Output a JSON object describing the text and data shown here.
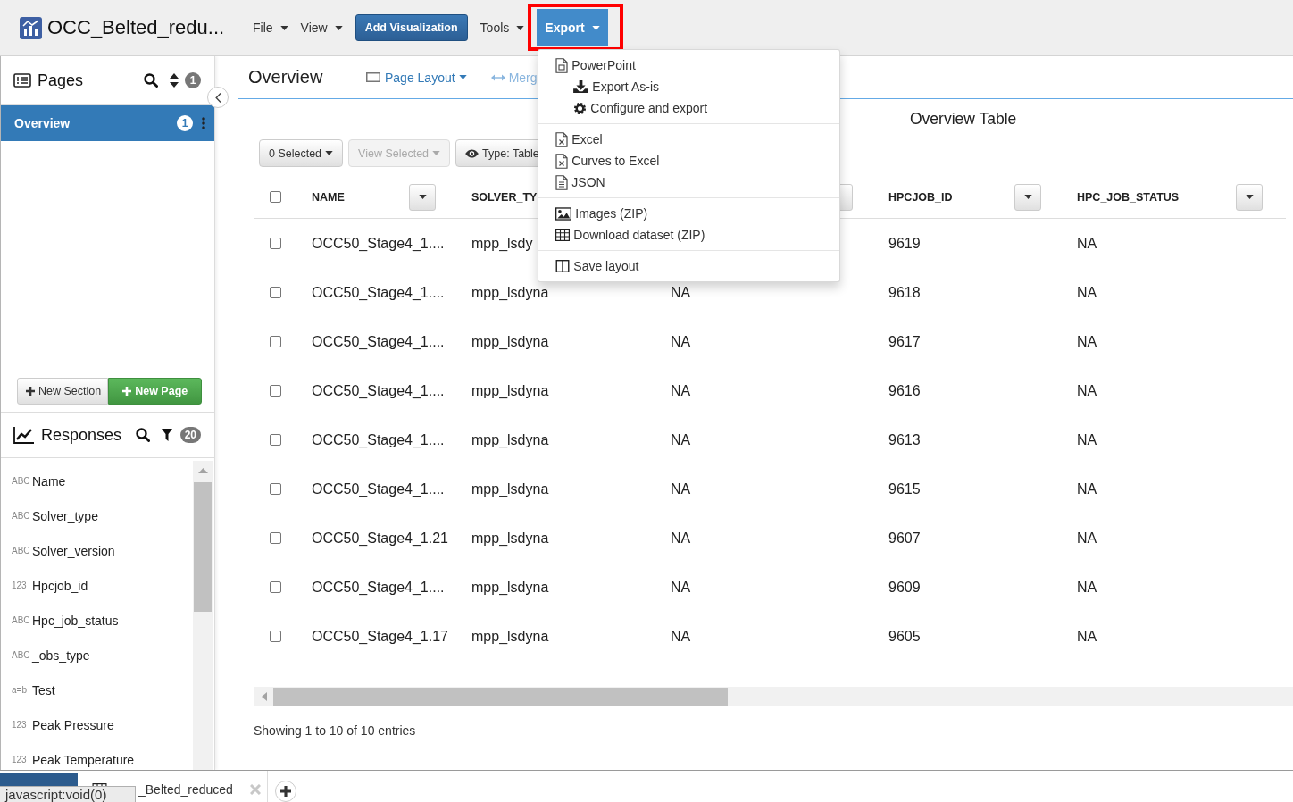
{
  "app_bar": {
    "title": "OCC_Belted_redu...",
    "menu": [
      {
        "label": "File",
        "kind": "dropdown",
        "expanded": false,
        "highlighted": false
      },
      {
        "label": "View",
        "kind": "dropdown",
        "expanded": false,
        "highlighted": false
      },
      {
        "label": "Add Visualization",
        "kind": "button",
        "expanded": false,
        "highlighted": false
      },
      {
        "label": "Tools",
        "kind": "dropdown",
        "expanded": false,
        "highlighted": false
      },
      {
        "label": "Export",
        "kind": "dropdown",
        "expanded": true,
        "highlighted": true,
        "menu": {
          "sections": [
            {
              "items": [
                {
                  "label": "PowerPoint",
                  "kind": "format"
                },
                {
                  "label": "Export As-is",
                  "kind": "action"
                },
                {
                  "label": "Configure and export",
                  "kind": "action"
                }
              ]
            },
            {
              "items": [
                {
                  "label": "Excel",
                  "kind": "format"
                },
                {
                  "label": "Curves to Excel",
                  "kind": "format"
                },
                {
                  "label": "JSON",
                  "kind": "format"
                }
              ]
            },
            {
              "items": [
                {
                  "label": "Images (ZIP)",
                  "kind": "format"
                },
                {
                  "label": "Download dataset (ZIP)",
                  "kind": "format"
                }
              ]
            },
            {
              "items": [
                {
                  "label": "Save layout",
                  "kind": "format"
                }
              ]
            }
          ]
        }
      }
    ]
  },
  "pages_panel": {
    "title": "Pages",
    "count": "1",
    "pages": [
      {
        "label": "Overview",
        "count": "1",
        "selected": true
      }
    ],
    "buttons": [
      {
        "label": "New Section",
        "kind": "default"
      },
      {
        "label": "New Page",
        "kind": "success"
      }
    ]
  },
  "responses_panel": {
    "title": "Responses",
    "count": "20",
    "items": [
      {
        "type": "ABC",
        "label": "Name"
      },
      {
        "type": "ABC",
        "label": "Solver_type"
      },
      {
        "type": "ABC",
        "label": "Solver_version"
      },
      {
        "type": "123",
        "label": "Hpcjob_id"
      },
      {
        "type": "ABC",
        "label": "Hpc_job_status"
      },
      {
        "type": "ABC",
        "label": "_obs_type"
      },
      {
        "type": "a=b",
        "label": "Test"
      },
      {
        "type": "123",
        "label": "Peak Pressure"
      },
      {
        "type": "123",
        "label": "Peak Temperature"
      }
    ]
  },
  "page_header": {
    "title": "Overview",
    "actions": [
      {
        "label": "Page Layout",
        "kind": "dropdown",
        "disabled": false
      },
      {
        "label": "Merg",
        "kind": "link",
        "disabled": true
      }
    ]
  },
  "visualization": {
    "title": "Overview Table",
    "toolbar": [
      {
        "label": "0 Selected",
        "kind": "dropdown",
        "disabled": false
      },
      {
        "label": "View Selected",
        "kind": "dropdown",
        "disabled": true
      },
      {
        "label": "Type: Table",
        "kind": "view-type",
        "disabled": false
      }
    ],
    "table": {
      "all_selected": false,
      "header": {
        "name": "NAME",
        "solver_type": "SOLVER_TY",
        "hpcjob_id": "HPCJOB_ID",
        "hpc_job_status": "HPC_JOB_STATUS"
      },
      "rows": [
        {
          "selected": false,
          "name": "OCC50_Stage4_1....",
          "solver_type": "mpp_lsdy",
          "hpcjob_id": "9619",
          "hpc_job_status": "NA"
        },
        {
          "selected": false,
          "name": "OCC50_Stage4_1....",
          "solver_type": "mpp_lsdyna",
          "column_3": "NA",
          "hpcjob_id": "9618",
          "hpc_job_status": "NA"
        },
        {
          "selected": false,
          "name": "OCC50_Stage4_1....",
          "solver_type": "mpp_lsdyna",
          "column_3": "NA",
          "hpcjob_id": "9617",
          "hpc_job_status": "NA"
        },
        {
          "selected": false,
          "name": "OCC50_Stage4_1....",
          "solver_type": "mpp_lsdyna",
          "column_3": "NA",
          "hpcjob_id": "9616",
          "hpc_job_status": "NA"
        },
        {
          "selected": false,
          "name": "OCC50_Stage4_1....",
          "solver_type": "mpp_lsdyna",
          "column_3": "NA",
          "hpcjob_id": "9613",
          "hpc_job_status": "NA"
        },
        {
          "selected": false,
          "name": "OCC50_Stage4_1....",
          "solver_type": "mpp_lsdyna",
          "column_3": "NA",
          "hpcjob_id": "9615",
          "hpc_job_status": "NA"
        },
        {
          "selected": false,
          "name": "OCC50_Stage4_1.21",
          "solver_type": "mpp_lsdyna",
          "column_3": "NA",
          "hpcjob_id": "9607",
          "hpc_job_status": "NA"
        },
        {
          "selected": false,
          "name": "OCC50_Stage4_1....",
          "solver_type": "mpp_lsdyna",
          "column_3": "NA",
          "hpcjob_id": "9609",
          "hpc_job_status": "NA"
        },
        {
          "selected": false,
          "name": "OCC50_Stage4_1.17",
          "solver_type": "mpp_lsdyna",
          "column_3": "NA",
          "hpcjob_id": "9605",
          "hpc_job_status": "NA"
        }
      ]
    },
    "footer": "Showing 1 to 10 of 10 entries"
  },
  "bottom_bar": {
    "tabs": [
      {
        "selected": true
      },
      {
        "label": "_Belted_reduced",
        "selected": false
      }
    ],
    "status_tip": "javascript:void(0)"
  }
}
